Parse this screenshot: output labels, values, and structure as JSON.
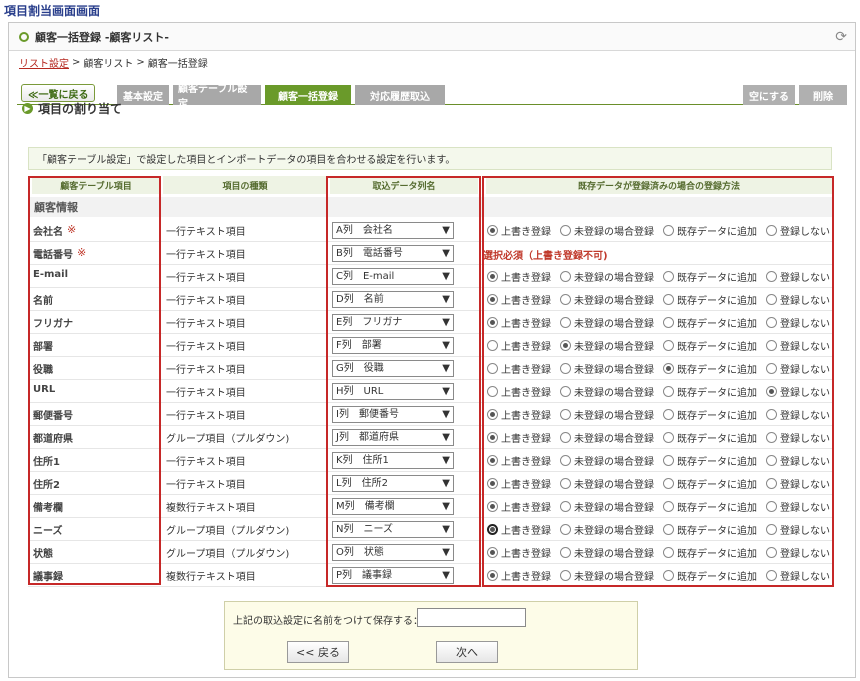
{
  "page_title": "項目割当画面画面",
  "header": {
    "title": "顧客一括登録 -顧客リスト-"
  },
  "breadcrumb": {
    "link": "リスト設定",
    "sep1": ">",
    "item2": "顧客リスト",
    "sep2": ">",
    "item3": "顧客一括登録"
  },
  "tabs": {
    "back": "≪一覧に戻る",
    "basic": "基本設定",
    "table": "顧客テーブル設定",
    "bulk": "顧客一括登録",
    "history": "対応履歴取込",
    "empty": "空にする",
    "delete": "削除"
  },
  "section_title": "項目の割り当て",
  "description": "「顧客テーブル設定」で設定した項目とインポートデータの項目を合わせる設定を行います。",
  "columns": {
    "field": "顧客テーブル項目",
    "kind": "項目の種類",
    "source": "取込データ列名",
    "method": "既存データが登録済みの場合の登録方法"
  },
  "group_label": "顧客情報",
  "radio_labels": [
    "上書き登録",
    "未登録の場合登録",
    "既存データに追加",
    "登録しない"
  ],
  "required_mark": "※",
  "warning_text": "選択必須（上書き登録不可)",
  "rows": [
    {
      "label": "会社名",
      "required": true,
      "kind": "一行テキスト項目",
      "source": "A列　会社名",
      "selected": 0
    },
    {
      "label": "電話番号",
      "required": true,
      "kind": "一行テキスト項目",
      "source": "B列　電話番号",
      "selected": -1
    },
    {
      "label": "E-mail",
      "required": false,
      "kind": "一行テキスト項目",
      "source": "C列　E-mail",
      "selected": 0
    },
    {
      "label": "名前",
      "required": false,
      "kind": "一行テキスト項目",
      "source": "D列　名前",
      "selected": 0
    },
    {
      "label": "フリガナ",
      "required": false,
      "kind": "一行テキスト項目",
      "source": "E列　フリガナ",
      "selected": 0
    },
    {
      "label": "部署",
      "required": false,
      "kind": "一行テキスト項目",
      "source": "F列　部署",
      "selected": 1
    },
    {
      "label": "役職",
      "required": false,
      "kind": "一行テキスト項目",
      "source": "G列　役職",
      "selected": 2
    },
    {
      "label": "URL",
      "required": false,
      "kind": "一行テキスト項目",
      "source": "H列　URL",
      "selected": 3
    },
    {
      "label": "郵便番号",
      "required": false,
      "kind": "一行テキスト項目",
      "source": "I列　郵便番号",
      "selected": 0
    },
    {
      "label": "都道府県",
      "required": false,
      "kind": "グループ項目（プルダウン)",
      "source": "J列　都道府県",
      "selected": 0
    },
    {
      "label": "住所1",
      "required": false,
      "kind": "一行テキスト項目",
      "source": "K列　住所1",
      "selected": 0
    },
    {
      "label": "住所2",
      "required": false,
      "kind": "一行テキスト項目",
      "source": "L列　住所2",
      "selected": 0
    },
    {
      "label": "備考欄",
      "required": false,
      "kind": "複数行テキスト項目",
      "source": "M列　備考欄",
      "selected": 0
    },
    {
      "label": "ニーズ",
      "required": false,
      "kind": "グループ項目（プルダウン)",
      "source": "N列　ニーズ",
      "selected": 0,
      "focus": true
    },
    {
      "label": "状態",
      "required": false,
      "kind": "グループ項目（プルダウン)",
      "source": "O列　状態",
      "selected": 0
    },
    {
      "label": "議事録",
      "required": false,
      "kind": "複数行テキスト項目",
      "source": "P列　議事録",
      "selected": 0
    }
  ],
  "save": {
    "label": "上記の取込設定に名前をつけて保存する：",
    "input_value": "",
    "back_button": "<< 戻る",
    "next_button": "次へ"
  }
}
